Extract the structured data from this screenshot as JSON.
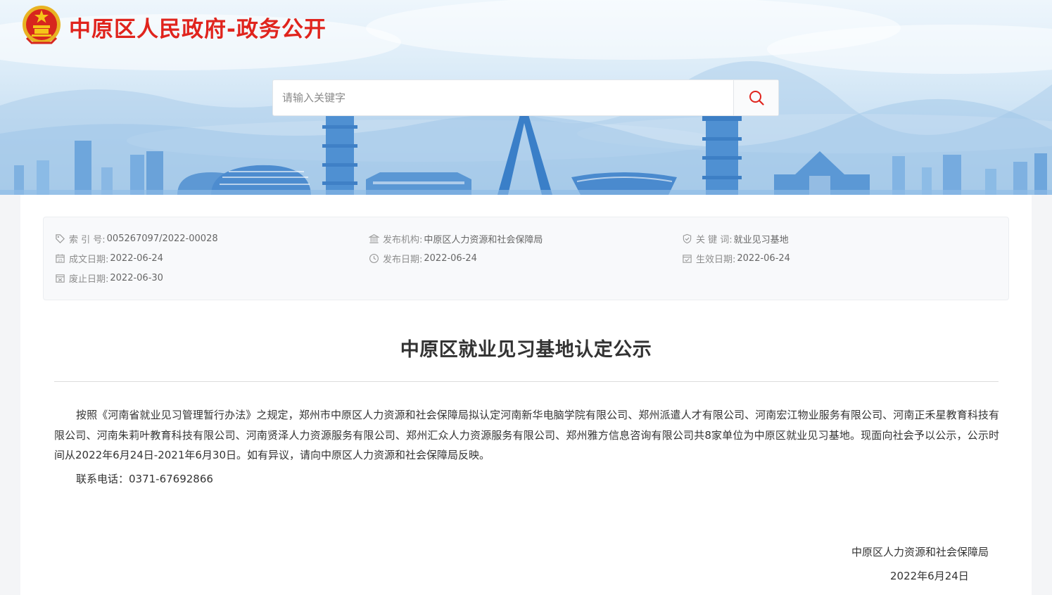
{
  "header": {
    "site_title": "中原区人民政府-政务公开"
  },
  "search": {
    "placeholder": "请输入关键字"
  },
  "meta": {
    "index_label": "索 引 号:",
    "index_value": "005267097/2022-00028",
    "publisher_label": "发布机构:",
    "publisher_value": "中原区人力资源和社会保障局",
    "keywords_label": "关 键 词:",
    "keywords_value": "就业见习基地",
    "created_label": "成文日期:",
    "created_value": "2022-06-24",
    "published_label": "发布日期:",
    "published_value": "2022-06-24",
    "effective_label": "生效日期:",
    "effective_value": "2022-06-24",
    "expiry_label": "废止日期:",
    "expiry_value": "2022-06-30"
  },
  "article": {
    "title": "中原区就业见习基地认定公示",
    "body": "按照《河南省就业见习管理暂行办法》之规定，郑州市中原区人力资源和社会保障局拟认定河南新华电脑学院有限公司、郑州派遣人才有限公司、河南宏江物业服务有限公司、河南正禾星教育科技有限公司、河南朱莉叶教育科技有限公司、河南贤泽人力资源服务有限公司、郑州汇众人力资源服务有限公司、郑州雅方信息咨询有限公司共8家单位为中原区就业见习基地。现面向社会予以公示，公示时间从2022年6月24日-2021年6月30日。如有异议，请向中原区人力资源和社会保障局反映。",
    "contact": "联系电话：0371-67692866",
    "sign_org": "中原区人力资源和社会保障局",
    "sign_date": "2022年6月24日"
  },
  "colors": {
    "title_red": "#e0241d",
    "icon_gray": "#9a9a9a",
    "search_icon_red": "#e0241d"
  },
  "icons": {
    "emblem": "national-emblem",
    "search": "search-icon",
    "index": "tag-icon",
    "publisher": "institution-icon",
    "keywords": "shield-check-icon",
    "created": "calendar-icon",
    "published": "clock-icon",
    "effective": "calendar-check-icon",
    "expiry": "calendar-x-icon"
  }
}
